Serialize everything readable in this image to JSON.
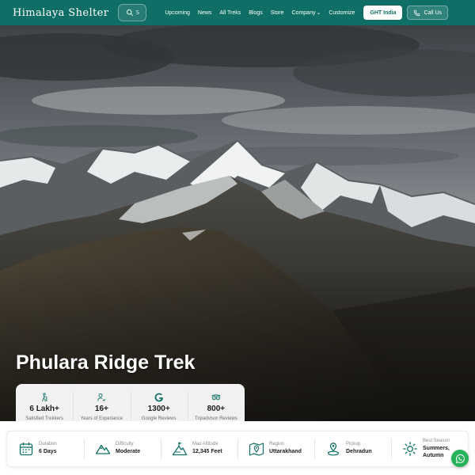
{
  "nav": {
    "brand": "Himalaya Shelter",
    "search_placeholder": "S",
    "menu": [
      {
        "label": "Upcoming"
      },
      {
        "label": "News"
      },
      {
        "label": "All Treks"
      },
      {
        "label": "Blogs"
      },
      {
        "label": "Store"
      },
      {
        "label": "Company"
      },
      {
        "label": "Customize"
      }
    ],
    "ght_button": "GHT India",
    "call_button": "Call Us"
  },
  "hero": {
    "title": "Phulara Ridge Trek",
    "stats": [
      {
        "value": "6 Lakh+",
        "label": "Satisfied Trekkers",
        "icon": "hiker-icon"
      },
      {
        "value": "16+",
        "label": "Years of Experiance",
        "icon": "user-check-icon"
      },
      {
        "value": "1300+",
        "label": "Google Reviews",
        "icon": "google-icon"
      },
      {
        "value": "800+",
        "label": "Tripadvisor Reviews",
        "icon": "tripadvisor-icon"
      }
    ]
  },
  "info": [
    {
      "label": "Duration",
      "value": "6 Days",
      "icon": "calendar-icon"
    },
    {
      "label": "Difficulty",
      "value": "Moderate",
      "icon": "mountain-icon"
    },
    {
      "label": "Max Altitude",
      "value": "12,345 Feet",
      "icon": "altitude-flag-icon"
    },
    {
      "label": "Region",
      "value": "Uttarakhand",
      "icon": "map-pin-icon"
    },
    {
      "label": "Pickup",
      "value": "Dehradun",
      "icon": "location-icon"
    },
    {
      "label": "Best Season",
      "value": "Summers, Autumn",
      "icon": "sun-icon"
    }
  ],
  "colors": {
    "accent": "#0f6f66",
    "whatsapp": "#25b25a"
  }
}
